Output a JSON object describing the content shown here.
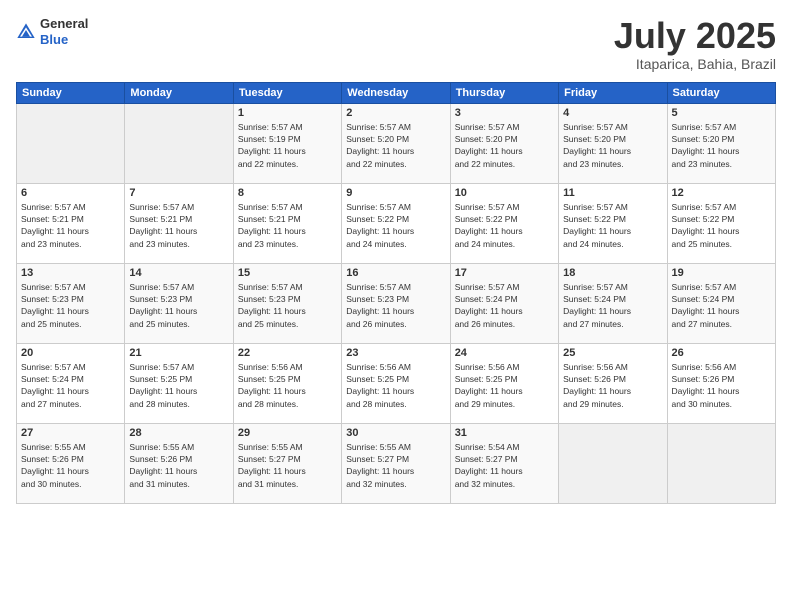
{
  "header": {
    "logo": {
      "general": "General",
      "blue": "Blue"
    },
    "title": "July 2025",
    "subtitle": "Itaparica, Bahia, Brazil"
  },
  "calendar": {
    "weekdays": [
      "Sunday",
      "Monday",
      "Tuesday",
      "Wednesday",
      "Thursday",
      "Friday",
      "Saturday"
    ],
    "weeks": [
      [
        {
          "day": "",
          "info": ""
        },
        {
          "day": "",
          "info": ""
        },
        {
          "day": "1",
          "info": "Sunrise: 5:57 AM\nSunset: 5:19 PM\nDaylight: 11 hours\nand 22 minutes."
        },
        {
          "day": "2",
          "info": "Sunrise: 5:57 AM\nSunset: 5:20 PM\nDaylight: 11 hours\nand 22 minutes."
        },
        {
          "day": "3",
          "info": "Sunrise: 5:57 AM\nSunset: 5:20 PM\nDaylight: 11 hours\nand 22 minutes."
        },
        {
          "day": "4",
          "info": "Sunrise: 5:57 AM\nSunset: 5:20 PM\nDaylight: 11 hours\nand 23 minutes."
        },
        {
          "day": "5",
          "info": "Sunrise: 5:57 AM\nSunset: 5:20 PM\nDaylight: 11 hours\nand 23 minutes."
        }
      ],
      [
        {
          "day": "6",
          "info": "Sunrise: 5:57 AM\nSunset: 5:21 PM\nDaylight: 11 hours\nand 23 minutes."
        },
        {
          "day": "7",
          "info": "Sunrise: 5:57 AM\nSunset: 5:21 PM\nDaylight: 11 hours\nand 23 minutes."
        },
        {
          "day": "8",
          "info": "Sunrise: 5:57 AM\nSunset: 5:21 PM\nDaylight: 11 hours\nand 23 minutes."
        },
        {
          "day": "9",
          "info": "Sunrise: 5:57 AM\nSunset: 5:22 PM\nDaylight: 11 hours\nand 24 minutes."
        },
        {
          "day": "10",
          "info": "Sunrise: 5:57 AM\nSunset: 5:22 PM\nDaylight: 11 hours\nand 24 minutes."
        },
        {
          "day": "11",
          "info": "Sunrise: 5:57 AM\nSunset: 5:22 PM\nDaylight: 11 hours\nand 24 minutes."
        },
        {
          "day": "12",
          "info": "Sunrise: 5:57 AM\nSunset: 5:22 PM\nDaylight: 11 hours\nand 25 minutes."
        }
      ],
      [
        {
          "day": "13",
          "info": "Sunrise: 5:57 AM\nSunset: 5:23 PM\nDaylight: 11 hours\nand 25 minutes."
        },
        {
          "day": "14",
          "info": "Sunrise: 5:57 AM\nSunset: 5:23 PM\nDaylight: 11 hours\nand 25 minutes."
        },
        {
          "day": "15",
          "info": "Sunrise: 5:57 AM\nSunset: 5:23 PM\nDaylight: 11 hours\nand 25 minutes."
        },
        {
          "day": "16",
          "info": "Sunrise: 5:57 AM\nSunset: 5:23 PM\nDaylight: 11 hours\nand 26 minutes."
        },
        {
          "day": "17",
          "info": "Sunrise: 5:57 AM\nSunset: 5:24 PM\nDaylight: 11 hours\nand 26 minutes."
        },
        {
          "day": "18",
          "info": "Sunrise: 5:57 AM\nSunset: 5:24 PM\nDaylight: 11 hours\nand 27 minutes."
        },
        {
          "day": "19",
          "info": "Sunrise: 5:57 AM\nSunset: 5:24 PM\nDaylight: 11 hours\nand 27 minutes."
        }
      ],
      [
        {
          "day": "20",
          "info": "Sunrise: 5:57 AM\nSunset: 5:24 PM\nDaylight: 11 hours\nand 27 minutes."
        },
        {
          "day": "21",
          "info": "Sunrise: 5:57 AM\nSunset: 5:25 PM\nDaylight: 11 hours\nand 28 minutes."
        },
        {
          "day": "22",
          "info": "Sunrise: 5:56 AM\nSunset: 5:25 PM\nDaylight: 11 hours\nand 28 minutes."
        },
        {
          "day": "23",
          "info": "Sunrise: 5:56 AM\nSunset: 5:25 PM\nDaylight: 11 hours\nand 28 minutes."
        },
        {
          "day": "24",
          "info": "Sunrise: 5:56 AM\nSunset: 5:25 PM\nDaylight: 11 hours\nand 29 minutes."
        },
        {
          "day": "25",
          "info": "Sunrise: 5:56 AM\nSunset: 5:26 PM\nDaylight: 11 hours\nand 29 minutes."
        },
        {
          "day": "26",
          "info": "Sunrise: 5:56 AM\nSunset: 5:26 PM\nDaylight: 11 hours\nand 30 minutes."
        }
      ],
      [
        {
          "day": "27",
          "info": "Sunrise: 5:55 AM\nSunset: 5:26 PM\nDaylight: 11 hours\nand 30 minutes."
        },
        {
          "day": "28",
          "info": "Sunrise: 5:55 AM\nSunset: 5:26 PM\nDaylight: 11 hours\nand 31 minutes."
        },
        {
          "day": "29",
          "info": "Sunrise: 5:55 AM\nSunset: 5:27 PM\nDaylight: 11 hours\nand 31 minutes."
        },
        {
          "day": "30",
          "info": "Sunrise: 5:55 AM\nSunset: 5:27 PM\nDaylight: 11 hours\nand 32 minutes."
        },
        {
          "day": "31",
          "info": "Sunrise: 5:54 AM\nSunset: 5:27 PM\nDaylight: 11 hours\nand 32 minutes."
        },
        {
          "day": "",
          "info": ""
        },
        {
          "day": "",
          "info": ""
        }
      ]
    ]
  }
}
